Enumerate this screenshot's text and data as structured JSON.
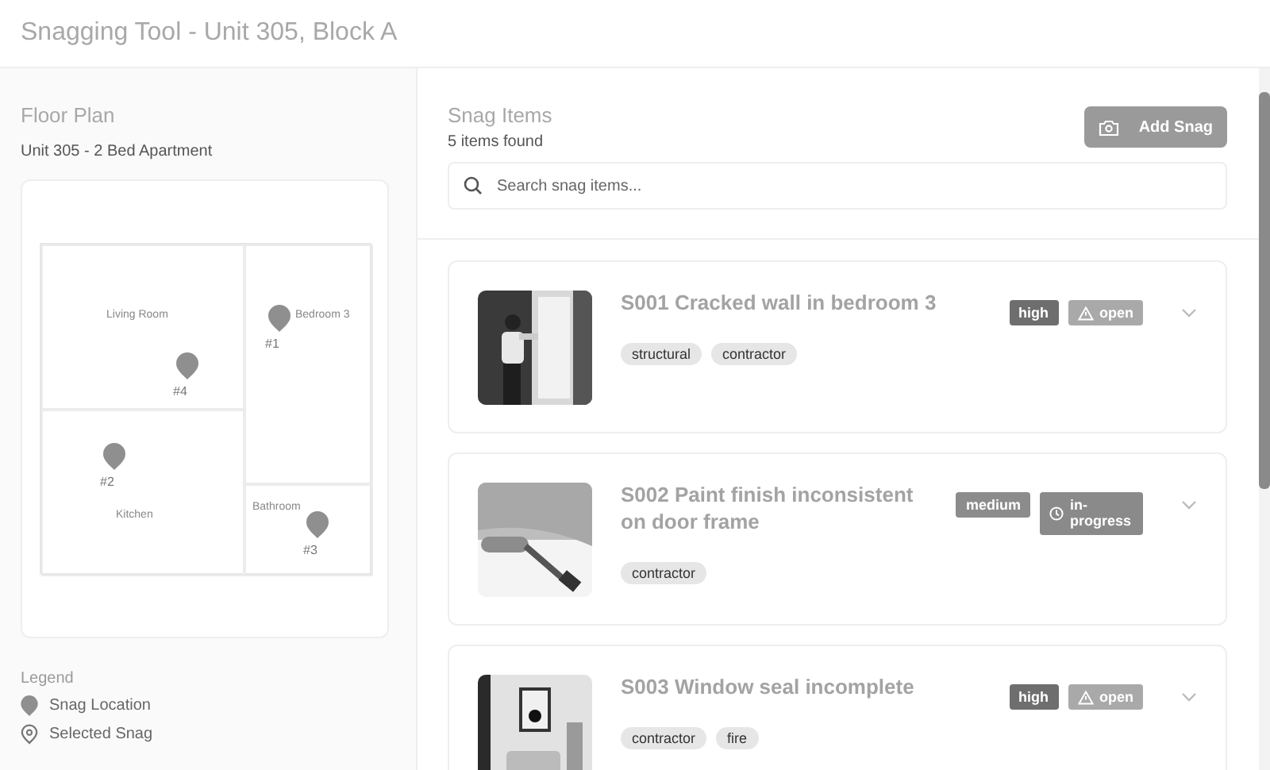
{
  "window": {
    "title": "Snagging Tool - Unit 305, Block A"
  },
  "floor_plan": {
    "title": "Floor Plan",
    "subtitle": "Unit 305 - 2 Bed Apartment",
    "rooms": [
      {
        "name": "Living Room"
      },
      {
        "name": "Bedroom 3"
      },
      {
        "name": "Kitchen"
      },
      {
        "name": "Bathroom"
      }
    ],
    "pins": [
      {
        "label": "#1"
      },
      {
        "label": "#4"
      },
      {
        "label": "#2"
      },
      {
        "label": "#3"
      }
    ]
  },
  "legend": {
    "title": "Legend",
    "items": [
      {
        "label": "Snag Location",
        "kind": "location"
      },
      {
        "label": "Selected Snag",
        "kind": "selected"
      }
    ]
  },
  "snag_list": {
    "title": "Snag Items",
    "count": "5 items found",
    "add_button": "Add Snag",
    "search": {
      "placeholder": "Search snag items..."
    },
    "items": [
      {
        "title": "S001 Cracked wall in bedroom 3",
        "severity": {
          "label": "high",
          "color": "#6e6e6e"
        },
        "status": {
          "label": "open",
          "kind": "open"
        },
        "tags": [
          "structural",
          "contractor"
        ]
      },
      {
        "title": "S002 Paint finish inconsistent on door frame",
        "severity": {
          "label": "medium",
          "color": "#8c8c8c"
        },
        "status": {
          "label": "in-progress",
          "kind": "progress"
        },
        "tags": [
          "contractor"
        ]
      },
      {
        "title": "S003 Window seal incomplete",
        "severity": {
          "label": "high",
          "color": "#6e6e6e"
        },
        "status": {
          "label": "open",
          "kind": "open"
        },
        "tags": [
          "contractor",
          "fire"
        ]
      }
    ]
  }
}
